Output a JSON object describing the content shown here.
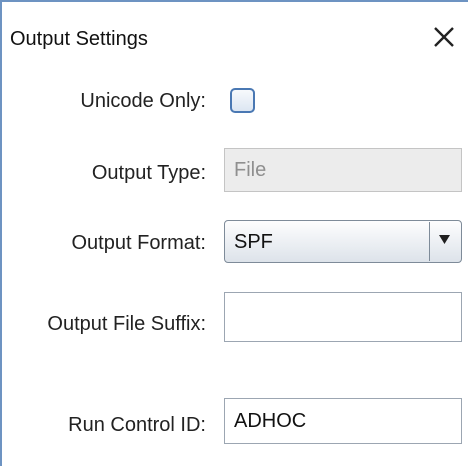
{
  "dialog": {
    "title": "Output Settings",
    "close_icon": "close-icon"
  },
  "fields": {
    "unicode_only": {
      "label": "Unicode Only:",
      "checked": false
    },
    "output_type": {
      "label": "Output Type:",
      "value": "File",
      "disabled": true
    },
    "output_format": {
      "label": "Output Format:",
      "value": "SPF",
      "arrow_icon": "triangle-down-icon"
    },
    "output_file_suffix": {
      "label": "Output File Suffix:",
      "value": ""
    },
    "run_control_id": {
      "label": "Run Control ID:",
      "value": "ADHOC"
    }
  },
  "colors": {
    "border_accent": "#6d93c2",
    "checkbox_border": "#4a78b3",
    "disabled_background": "#ececec"
  }
}
